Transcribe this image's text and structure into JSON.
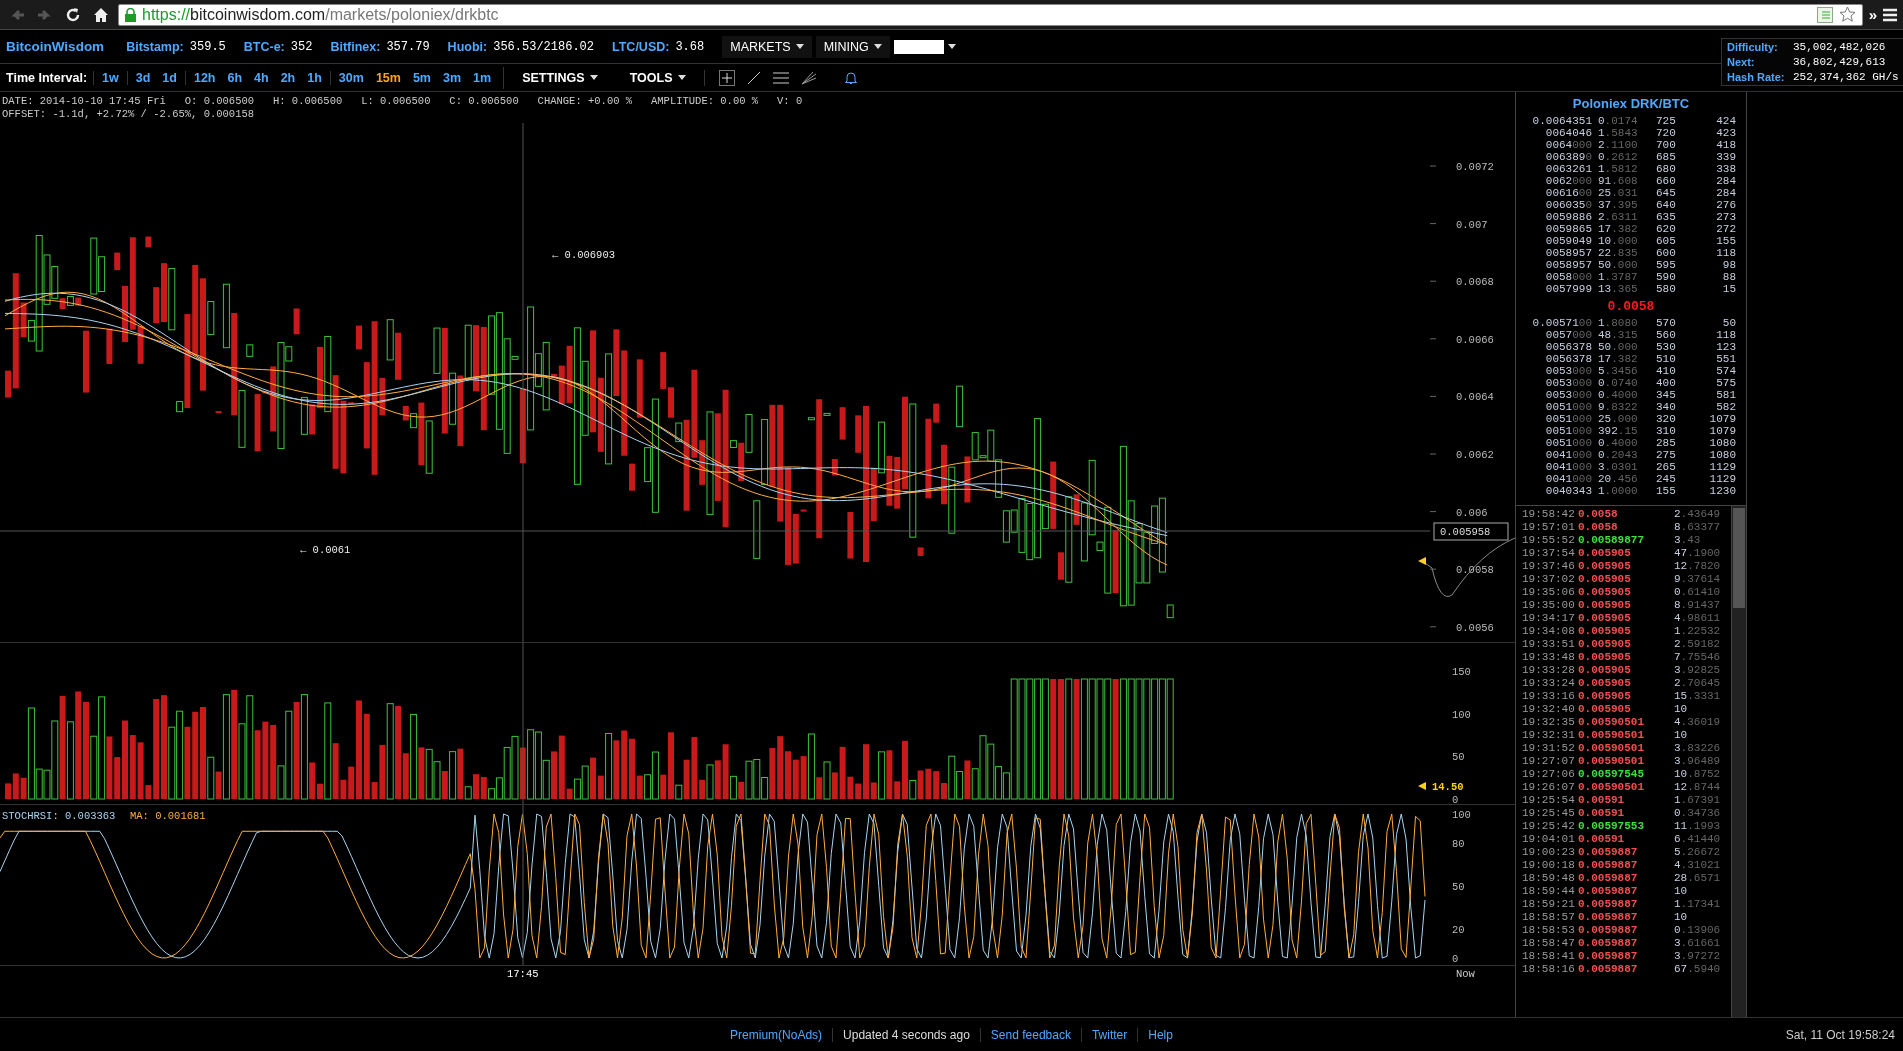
{
  "browser": {
    "nav_buttons": [
      {
        "kind": "back",
        "disabled": true
      },
      {
        "kind": "forward",
        "disabled": true
      },
      {
        "kind": "reload",
        "disabled": false
      },
      {
        "kind": "home",
        "disabled": false
      }
    ],
    "url": {
      "scheme": "https://",
      "host": "bitcoinwisdom.com",
      "path": "/markets/poloniex/drkbtc"
    },
    "overflow": "»"
  },
  "header": {
    "logo": "BitcoinWisdom",
    "tickers": [
      {
        "label": "Bitstamp:",
        "value": "359.5"
      },
      {
        "label": "BTC-e:",
        "value": "352"
      },
      {
        "label": "Bitfinex:",
        "value": "357.79"
      },
      {
        "label": "Huobi:",
        "value": "356.53/2186.02"
      },
      {
        "label": "LTC/USD:",
        "value": "3.68"
      }
    ],
    "menus": [
      "MARKETS",
      "MINING"
    ]
  },
  "network_stats": [
    {
      "label": "Difficulty:",
      "value": "35,002,482,026"
    },
    {
      "label": "Next:",
      "value": "36,802,429,613"
    },
    {
      "label": "Hash Rate:",
      "value": "252,374,362 GH/s"
    }
  ],
  "toolbar": {
    "interval_label": "Time Interval:",
    "interval_groups": [
      [
        {
          "label": "1w",
          "selected": false
        }
      ],
      [
        {
          "label": "3d",
          "selected": false
        },
        {
          "label": "1d",
          "selected": false
        }
      ],
      [
        {
          "label": "12h",
          "selected": false
        },
        {
          "label": "6h",
          "selected": false
        },
        {
          "label": "4h",
          "selected": false
        },
        {
          "label": "2h",
          "selected": false
        },
        {
          "label": "1h",
          "selected": false
        }
      ],
      [
        {
          "label": "30m",
          "selected": false
        },
        {
          "label": "15m",
          "selected": true
        },
        {
          "label": "5m",
          "selected": false
        },
        {
          "label": "3m",
          "selected": false
        },
        {
          "label": "1m",
          "selected": false
        }
      ]
    ],
    "menus": [
      "SETTINGS",
      "TOOLS"
    ]
  },
  "info_lines": [
    "DATE: 2014-10-10 17:45 Fri   O: 0.006500   H: 0.006500   L: 0.006500   C: 0.006500   CHANGE: +0.00 %   AMPLITUDE: 0.00 %   V: 0",
    "OFFSET: -1.1d, +2.72% / -2.65%, 0.000158"
  ],
  "price_chart": {
    "yticks": [
      "0.0072",
      "0.007",
      "0.0068",
      "0.0066",
      "0.0064",
      "0.0062",
      "0.006",
      "0.0058",
      "0.0056"
    ],
    "cursor_price": "0.005958",
    "annotations": [
      "← 0.006903",
      "← 0.0061"
    ]
  },
  "volume_chart": {
    "yticks": [
      "150",
      "100",
      "50",
      "0"
    ],
    "last_volume": "14.50"
  },
  "stoch_chart": {
    "stochrsi": "STOCHRSI: 0.003363",
    "ma": "MA: 0.001681",
    "yticks": [
      "100",
      "80",
      "50",
      "20",
      "0"
    ]
  },
  "time_axis": {
    "cursor_time": "17:45",
    "end_label": "Now"
  },
  "order_book": {
    "title": "Poloniex DRK/BTC",
    "last_price": "0.0058",
    "asks": [
      [
        "0.0064351",
        "0.0174",
        "725",
        "424"
      ],
      [
        "0064046",
        "1.5843",
        "720",
        "423"
      ],
      [
        "0064000",
        "2.1100",
        "700",
        "418"
      ],
      [
        "0063890",
        "0.2612",
        "685",
        "339"
      ],
      [
        "0063261",
        "1.5812",
        "680",
        "338"
      ],
      [
        "0062000",
        "91.608",
        "660",
        "284"
      ],
      [
        "0061600",
        "25.031",
        "645",
        "284"
      ],
      [
        "0060350",
        "37.395",
        "640",
        "276"
      ],
      [
        "0059886",
        "2.6311",
        "635",
        "273"
      ],
      [
        "0059865",
        "17.382",
        "620",
        "272"
      ],
      [
        "0059049",
        "10.000",
        "605",
        "155"
      ],
      [
        "0058957",
        "22.835",
        "600",
        "118"
      ],
      [
        "0058957",
        "50.000",
        "595",
        "98"
      ],
      [
        "0058000",
        "1.3787",
        "590",
        "88"
      ],
      [
        "0057999",
        "13.365",
        "580",
        "15"
      ]
    ],
    "bids": [
      [
        "0.0057100",
        "1.8080",
        "570",
        "50"
      ],
      [
        "0057000",
        "48.315",
        "560",
        "118"
      ],
      [
        "0056378",
        "50.000",
        "530",
        "123"
      ],
      [
        "0056378",
        "17.382",
        "510",
        "551"
      ],
      [
        "0053000",
        "5.3456",
        "410",
        "574"
      ],
      [
        "0053000",
        "0.0740",
        "400",
        "575"
      ],
      [
        "0053000",
        "0.4000",
        "345",
        "581"
      ],
      [
        "0051000",
        "9.8322",
        "340",
        "582"
      ],
      [
        "0051000",
        "25.000",
        "320",
        "1079"
      ],
      [
        "0051000",
        "392.15",
        "310",
        "1079"
      ],
      [
        "0051000",
        "0.4000",
        "285",
        "1080"
      ],
      [
        "0041000",
        "0.2043",
        "275",
        "1080"
      ],
      [
        "0041000",
        "3.0301",
        "265",
        "1129"
      ],
      [
        "0041000",
        "20.456",
        "245",
        "1129"
      ],
      [
        "0040343",
        "1.0000",
        "155",
        "1230"
      ]
    ]
  },
  "trades": [
    {
      "time": "19:58:42",
      "price": "0.0058",
      "color": "#f05050",
      "amount": "2.43649"
    },
    {
      "time": "19:57:01",
      "price": "0.0058",
      "color": "#f05050",
      "amount": "8.63377"
    },
    {
      "time": "19:55:52",
      "price": "0.00589877",
      "color": "#3ee03e",
      "amount": "3.43"
    },
    {
      "time": "19:37:54",
      "price": "0.005905",
      "color": "#f05050",
      "amount": "47.1900"
    },
    {
      "time": "19:37:46",
      "price": "0.005905",
      "color": "#f05050",
      "amount": "12.7820"
    },
    {
      "time": "19:37:02",
      "price": "0.005905",
      "color": "#f05050",
      "amount": "9.37614"
    },
    {
      "time": "19:35:06",
      "price": "0.005905",
      "color": "#f05050",
      "amount": "0.61410"
    },
    {
      "time": "19:35:00",
      "price": "0.005905",
      "color": "#f05050",
      "amount": "8.91437"
    },
    {
      "time": "19:34:17",
      "price": "0.005905",
      "color": "#f05050",
      "amount": "4.98611"
    },
    {
      "time": "19:34:08",
      "price": "0.005905",
      "color": "#f05050",
      "amount": "1.22532"
    },
    {
      "time": "19:33:51",
      "price": "0.005905",
      "color": "#f05050",
      "amount": "2.59182"
    },
    {
      "time": "19:33:48",
      "price": "0.005905",
      "color": "#f05050",
      "amount": "7.75546"
    },
    {
      "time": "19:33:28",
      "price": "0.005905",
      "color": "#f05050",
      "amount": "3.92825"
    },
    {
      "time": "19:33:24",
      "price": "0.005905",
      "color": "#f05050",
      "amount": "2.70645"
    },
    {
      "time": "19:33:16",
      "price": "0.005905",
      "color": "#f05050",
      "amount": "15.3331"
    },
    {
      "time": "19:32:40",
      "price": "0.005905",
      "color": "#f05050",
      "amount": "10"
    },
    {
      "time": "19:32:35",
      "price": "0.00590501",
      "color": "#f05050",
      "amount": "4.36019"
    },
    {
      "time": "19:32:31",
      "price": "0.00590501",
      "color": "#f05050",
      "amount": "10"
    },
    {
      "time": "19:31:52",
      "price": "0.00590501",
      "color": "#f05050",
      "amount": "3.83226"
    },
    {
      "time": "19:27:07",
      "price": "0.00590501",
      "color": "#f05050",
      "amount": "3.96489"
    },
    {
      "time": "19:27:06",
      "price": "0.00597545",
      "color": "#3ee03e",
      "amount": "10.8752"
    },
    {
      "time": "19:26:07",
      "price": "0.00590501",
      "color": "#f05050",
      "amount": "12.8744"
    },
    {
      "time": "19:25:54",
      "price": "0.00591",
      "color": "#f05050",
      "amount": "1.67391"
    },
    {
      "time": "19:25:45",
      "price": "0.00591",
      "color": "#f05050",
      "amount": "0.34736"
    },
    {
      "time": "19:25:42",
      "price": "0.00597553",
      "color": "#3ee03e",
      "amount": "11.1993"
    },
    {
      "time": "19:04:01",
      "price": "0.00591",
      "color": "#f05050",
      "amount": "6.41440"
    },
    {
      "time": "19:00:23",
      "price": "0.0059887",
      "color": "#f05050",
      "amount": "5.26672"
    },
    {
      "time": "19:00:18",
      "price": "0.0059887",
      "color": "#f05050",
      "amount": "4.31021"
    },
    {
      "time": "18:59:48",
      "price": "0.0059887",
      "color": "#f05050",
      "amount": "28.6571"
    },
    {
      "time": "18:59:44",
      "price": "0.0059887",
      "color": "#f05050",
      "amount": "10"
    },
    {
      "time": "18:59:21",
      "price": "0.0059887",
      "color": "#f05050",
      "amount": "1.17341"
    },
    {
      "time": "18:58:57",
      "price": "0.0059887",
      "color": "#f05050",
      "amount": "10"
    },
    {
      "time": "18:58:53",
      "price": "0.0059887",
      "color": "#f05050",
      "amount": "0.13906"
    },
    {
      "time": "18:58:47",
      "price": "0.0059887",
      "color": "#f05050",
      "amount": "3.61661"
    },
    {
      "time": "18:58:41",
      "price": "0.0059887",
      "color": "#f05050",
      "amount": "3.97272"
    },
    {
      "time": "18:58:16",
      "price": "0.0059887",
      "color": "#f05050",
      "amount": "67.5940"
    }
  ],
  "footer": {
    "links": [
      {
        "label": "Premium(NoAds)",
        "kind": "link"
      },
      {
        "label": "Updated 4 seconds ago",
        "kind": "status"
      },
      {
        "label": "Send feedback",
        "kind": "link"
      },
      {
        "label": "Twitter",
        "kind": "link"
      },
      {
        "label": "Help",
        "kind": "link"
      }
    ],
    "clock": "Sat, 11 Oct 19:58:24"
  }
}
